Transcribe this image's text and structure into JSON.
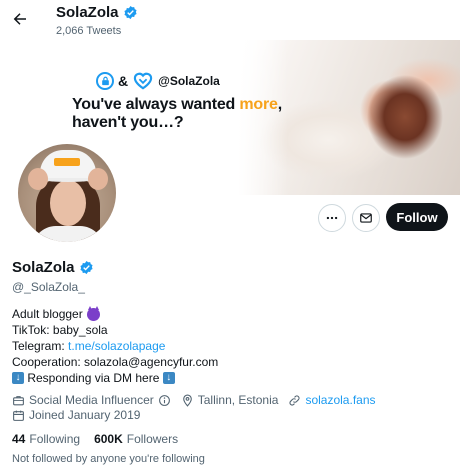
{
  "header": {
    "title": "SolaZola",
    "tweet_count": "2,066 Tweets"
  },
  "banner": {
    "amp": "&",
    "handle": "@SolaZola",
    "headline_line1_pre": "You've always wanted ",
    "headline_line1_accent": "more",
    "headline_line1_post": ",",
    "headline_line2": "haven't you…?"
  },
  "actions": {
    "follow_label": "Follow"
  },
  "profile": {
    "display_name": "SolaZola",
    "username": "@_SolaZola_",
    "bio": {
      "line1": "Adult blogger",
      "tiktok": "TikTok: baby_sola",
      "telegram_label": "Telegram: ",
      "telegram_link": "t.me/solazolapage",
      "cooperation": "Cooperation: solazola@agencyfur.com",
      "dm_text": " Responding via DM here "
    },
    "category": "Social Media Influencer",
    "location": "Tallinn, Estonia",
    "website": "solazola.fans",
    "joined": "Joined January 2019",
    "following_count": "44",
    "following_label": "Following",
    "followers_count": "600K",
    "followers_label": "Followers",
    "cut_text": "Not followed by anyone you're following"
  },
  "colors": {
    "accent_blue": "#1d9bf0",
    "banner_accent": "#f7a21b",
    "follow_button_bg": "#0f1419",
    "secondary_text": "#536471"
  },
  "icons": {
    "back": "arrow-left-icon",
    "verified": "verified-badge-icon",
    "more": "more-horizontal-icon",
    "message": "envelope-icon",
    "category": "briefcase-icon",
    "info": "info-icon",
    "location": "location-pin-icon",
    "website": "link-icon",
    "joined": "calendar-icon"
  }
}
